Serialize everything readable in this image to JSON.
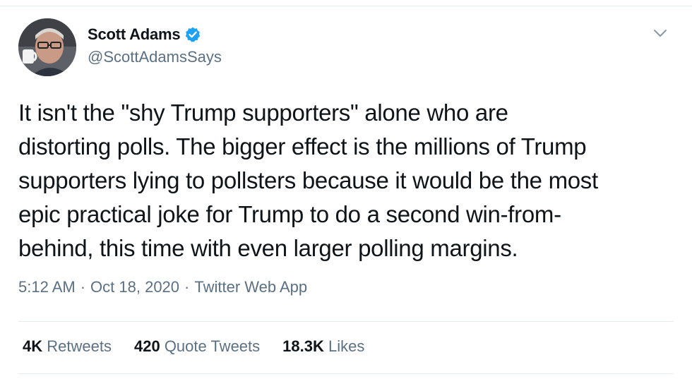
{
  "author": {
    "display_name": "Scott Adams",
    "handle": "@ScottAdamsSays",
    "verified": true,
    "avatar_icon": "profile-photo"
  },
  "tweet": {
    "lines": [
      "It isn't the \"shy Trump supporters\" alone who are",
      "distorting polls. The bigger effect is the millions of Trump",
      "supporters lying to pollsters because it would be the most",
      "epic practical joke for Trump to do a second win-from-",
      "behind, this time with even larger polling margins."
    ]
  },
  "meta": {
    "time": "5:12 AM",
    "separator": "·",
    "date": "Oct 18, 2020",
    "source": "Twitter Web App"
  },
  "stats": {
    "retweets": {
      "count": "4K",
      "label": "Retweets"
    },
    "quotes": {
      "count": "420",
      "label": "Quote Tweets"
    },
    "likes": {
      "count": "18.3K",
      "label": "Likes"
    }
  },
  "colors": {
    "text": "#0f1419",
    "secondary": "#5b7083",
    "verified": "#1da1f2",
    "divider": "#e6ecf0"
  }
}
